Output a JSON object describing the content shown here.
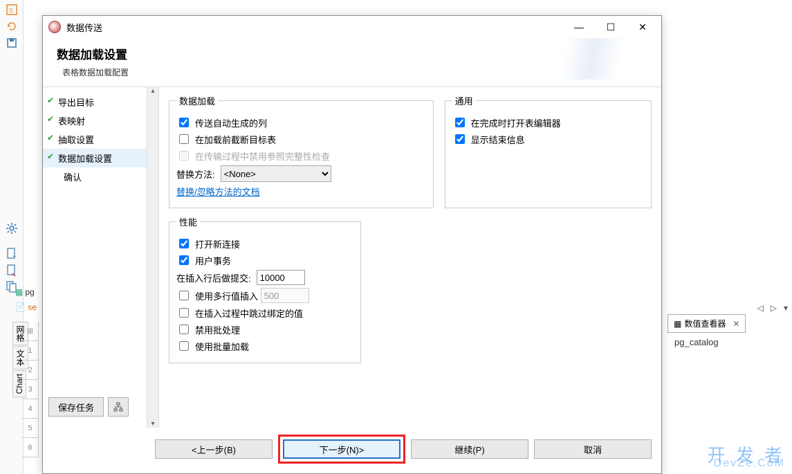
{
  "dialog": {
    "title": "数据传送",
    "heading": "数据加载设置",
    "subtitle": "表格数据加载配置"
  },
  "nav": {
    "items": [
      {
        "label": "导出目标",
        "done": true
      },
      {
        "label": "表映射",
        "done": true
      },
      {
        "label": "抽取设置",
        "done": true
      },
      {
        "label": "数据加载设置",
        "done": true,
        "active": true
      },
      {
        "label": "确认",
        "done": false
      }
    ],
    "save_task": "保存任务"
  },
  "groups": {
    "data_load": {
      "legend": "数据加载",
      "cb_autogen": "传送自动生成的列",
      "cb_truncate": "在加载前截断目标表",
      "cb_disable_ref": "在传输过程中禁用参照完整性检查",
      "replace_label": "替换方法:",
      "replace_value": "<None>",
      "doc_link": "替换/忽略方法的文档"
    },
    "general": {
      "legend": "通用",
      "cb_open_editor": "在完成时打开表编辑器",
      "cb_show_result": "显示结束信息"
    },
    "perf": {
      "legend": "性能",
      "cb_new_conn": "打开新连接",
      "cb_user_tx": "用户事务",
      "commit_label": "在插入行后做提交:",
      "commit_value": "10000",
      "cb_multirow": "使用多行值插入",
      "multirow_value": "500",
      "cb_skip_bind": "在插入过程中跳过绑定的值",
      "cb_disable_batch": "禁用批处理",
      "cb_bulk_load": "使用批量加载"
    }
  },
  "buttons": {
    "back": "<上一步(B)",
    "next": "下一步(N)>",
    "continue": "继续(P)",
    "cancel": "取消"
  },
  "bg": {
    "pg_label": "pg",
    "se_label": "se",
    "tab_grid": "网格",
    "tab_text": "文本",
    "tab_chart": "Chart",
    "right_tab": "数值查看器",
    "right_body": "pg_catalog",
    "watermark1": "开 发 者",
    "watermark2": "DevZe.CoM"
  }
}
